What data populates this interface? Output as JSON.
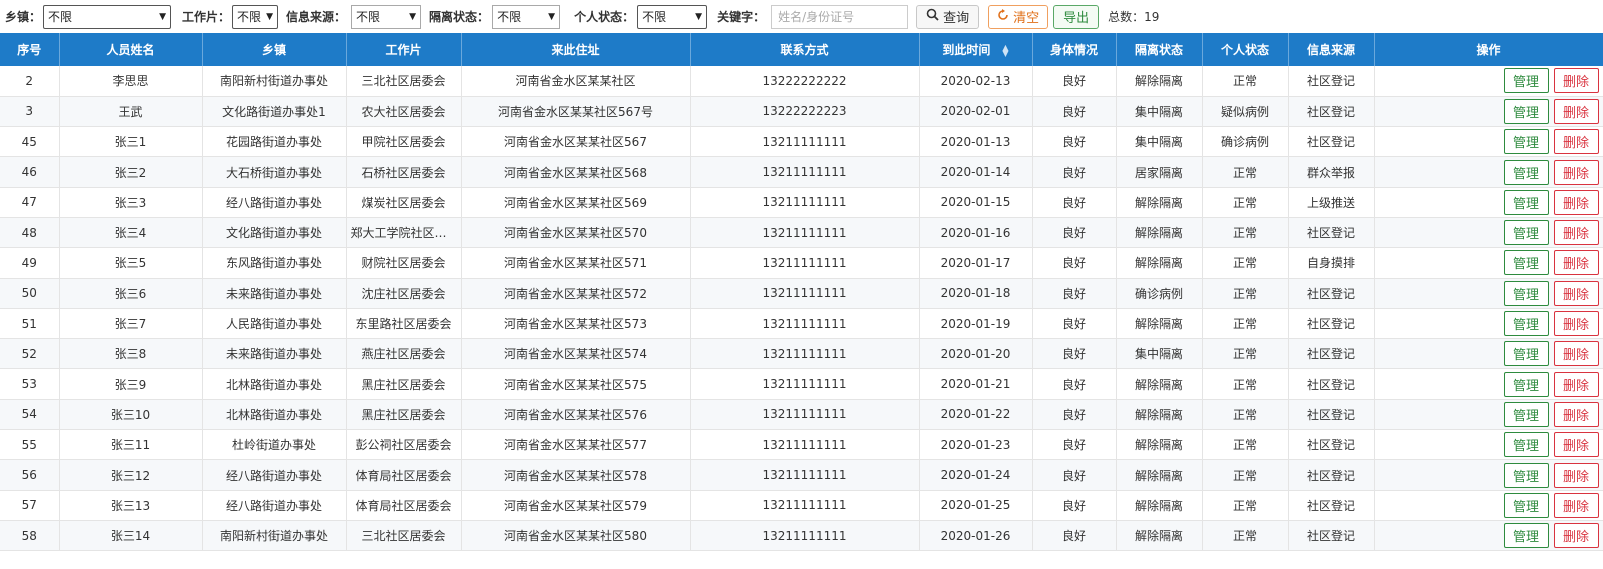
{
  "filters": {
    "town_label": "乡镇：",
    "town_value": "不限",
    "workarea_label": "工作片：",
    "workarea_value": "不限",
    "source_label": "信息来源：",
    "source_value": "不限",
    "isolation_label": "隔离状态：",
    "isolation_value": "不限",
    "personal_label": "个人状态：",
    "personal_value": "不限",
    "keyword_label": "关键字：",
    "keyword_placeholder": "姓名/身份证号",
    "query_label": "查询",
    "clear_label": "清空",
    "export_label": "导出",
    "total_text": "总数：19"
  },
  "table": {
    "headers": [
      "序号",
      "人员姓名",
      "乡镇",
      "工作片",
      "来此住址",
      "联系方式",
      "到此时间",
      "身体情况",
      "隔离状态",
      "个人状态",
      "信息来源",
      "操作"
    ],
    "manage_label": "管理",
    "delete_label": "删除",
    "rows": [
      [
        "2",
        "李思思",
        "南阳新村街道办事处",
        "三北社区居委会",
        "河南省金水区某某社区",
        "13222222222",
        "2020-02-13",
        "良好",
        "解除隔离",
        "正常",
        "社区登记"
      ],
      [
        "3",
        "王武",
        "文化路街道办事处1",
        "农大社区居委会",
        "河南省金水区某某社区567号",
        "13222222223",
        "2020-02-01",
        "良好",
        "集中隔离",
        "疑似病例",
        "社区登记"
      ],
      [
        "45",
        "张三1",
        "花园路街道办事处",
        "甲院社区居委会",
        "河南省金水区某某社区567",
        "13211111111",
        "2020-01-13",
        "良好",
        "集中隔离",
        "确诊病例",
        "社区登记"
      ],
      [
        "46",
        "张三2",
        "大石桥街道办事处",
        "石桥社区居委会",
        "河南省金水区某某社区568",
        "13211111111",
        "2020-01-14",
        "良好",
        "居家隔离",
        "正常",
        "群众举报"
      ],
      [
        "47",
        "张三3",
        "经八路街道办事处",
        "煤炭社区居委会",
        "河南省金水区某某社区569",
        "13211111111",
        "2020-01-15",
        "良好",
        "解除隔离",
        "正常",
        "上级推送"
      ],
      [
        "48",
        "张三4",
        "文化路街道办事处",
        "郑大工学院社区居...",
        "河南省金水区某某社区570",
        "13211111111",
        "2020-01-16",
        "良好",
        "解除隔离",
        "正常",
        "社区登记"
      ],
      [
        "49",
        "张三5",
        "东风路街道办事处",
        "财院社区居委会",
        "河南省金水区某某社区571",
        "13211111111",
        "2020-01-17",
        "良好",
        "解除隔离",
        "正常",
        "自身摸排"
      ],
      [
        "50",
        "张三6",
        "未来路街道办事处",
        "沈庄社区居委会",
        "河南省金水区某某社区572",
        "13211111111",
        "2020-01-18",
        "良好",
        "确诊病例",
        "正常",
        "社区登记"
      ],
      [
        "51",
        "张三7",
        "人民路街道办事处",
        "东里路社区居委会",
        "河南省金水区某某社区573",
        "13211111111",
        "2020-01-19",
        "良好",
        "解除隔离",
        "正常",
        "社区登记"
      ],
      [
        "52",
        "张三8",
        "未来路街道办事处",
        "燕庄社区居委会",
        "河南省金水区某某社区574",
        "13211111111",
        "2020-01-20",
        "良好",
        "集中隔离",
        "正常",
        "社区登记"
      ],
      [
        "53",
        "张三9",
        "北林路街道办事处",
        "黑庄社区居委会",
        "河南省金水区某某社区575",
        "13211111111",
        "2020-01-21",
        "良好",
        "解除隔离",
        "正常",
        "社区登记"
      ],
      [
        "54",
        "张三10",
        "北林路街道办事处",
        "黑庄社区居委会",
        "河南省金水区某某社区576",
        "13211111111",
        "2020-01-22",
        "良好",
        "解除隔离",
        "正常",
        "社区登记"
      ],
      [
        "55",
        "张三11",
        "杜岭街道办事处",
        "彭公祠社区居委会",
        "河南省金水区某某社区577",
        "13211111111",
        "2020-01-23",
        "良好",
        "解除隔离",
        "正常",
        "社区登记"
      ],
      [
        "56",
        "张三12",
        "经八路街道办事处",
        "体育局社区居委会",
        "河南省金水区某某社区578",
        "13211111111",
        "2020-01-24",
        "良好",
        "解除隔离",
        "正常",
        "社区登记"
      ],
      [
        "57",
        "张三13",
        "经八路街道办事处",
        "体育局社区居委会",
        "河南省金水区某某社区579",
        "13211111111",
        "2020-01-25",
        "良好",
        "解除隔离",
        "正常",
        "社区登记"
      ],
      [
        "58",
        "张三14",
        "南阳新村街道办事处",
        "三北社区居委会",
        "河南省金水区某某社区580",
        "13211111111",
        "2020-01-26",
        "良好",
        "解除隔离",
        "正常",
        "社区登记"
      ]
    ]
  },
  "colors": {
    "header_bg": "#1e7bc8",
    "manage": "#2e8b3e",
    "delete": "#d9333f",
    "clear": "#e0701a"
  }
}
